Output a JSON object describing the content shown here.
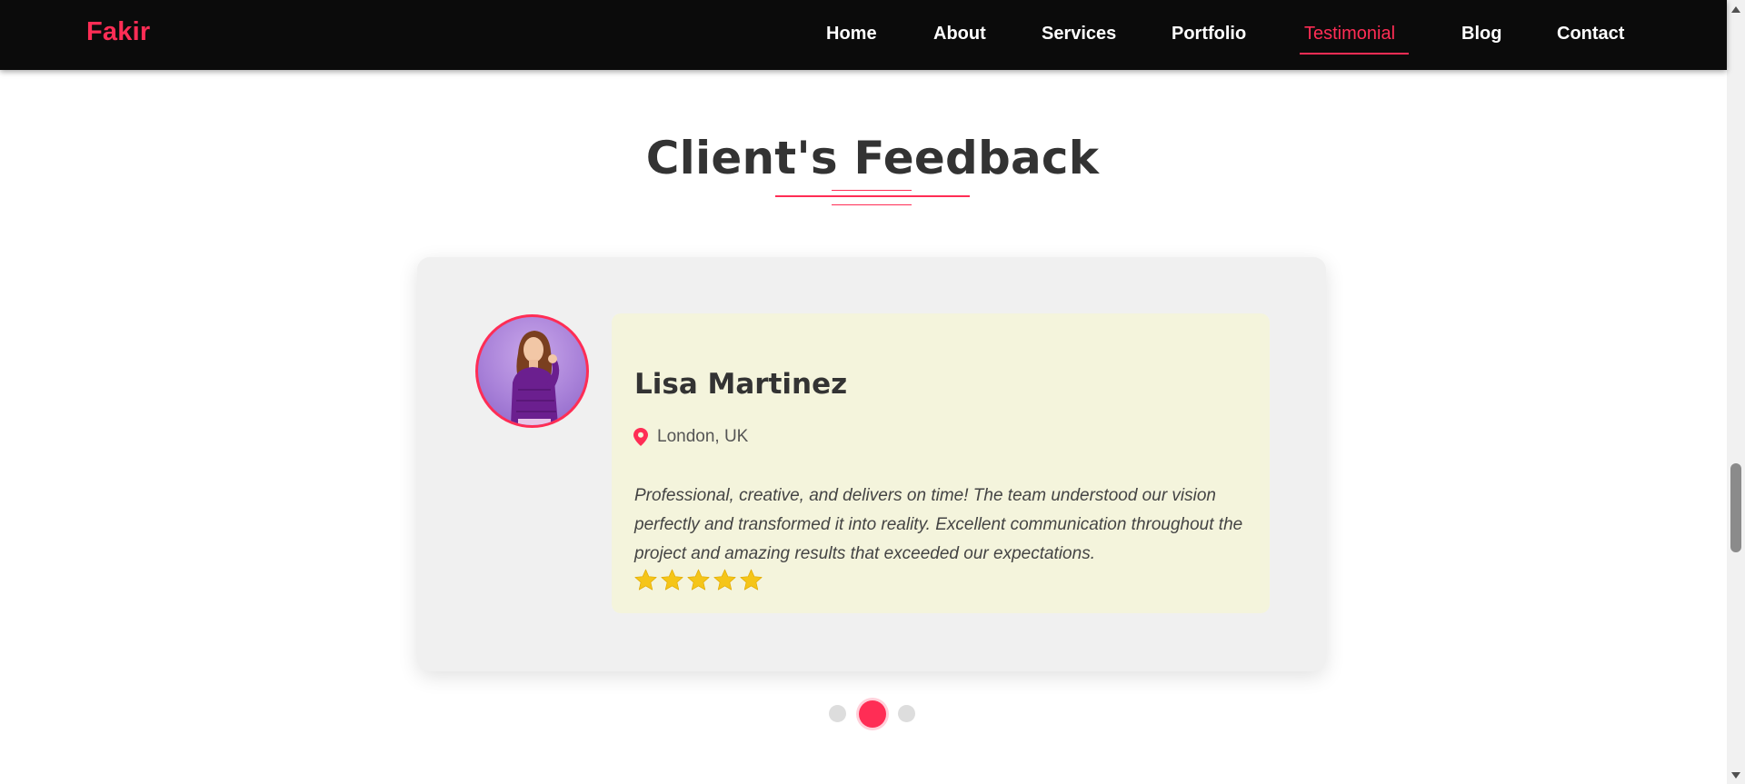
{
  "brand": {
    "logo": "Fakir",
    "accent_color": "#ff2d55"
  },
  "nav": {
    "items": [
      {
        "label": "Home"
      },
      {
        "label": "About"
      },
      {
        "label": "Services"
      },
      {
        "label": "Portfolio"
      },
      {
        "label": "Testimonial",
        "active": true
      },
      {
        "label": "Blog"
      },
      {
        "label": "Contact"
      }
    ]
  },
  "section": {
    "title": "Client's Feedback"
  },
  "testimonial": {
    "name": "Lisa Martinez",
    "location": "London, UK",
    "location_icon": "map-pin-icon",
    "text": "Professional, creative, and delivers on time! The team understood our vision perfectly and transformed it into reality. Excellent communication throughout the project and amazing results that exceeded our expectations.",
    "rating": 5,
    "rating_max": 5,
    "star_color": "#f5c518",
    "content_bg": "#f4f4dc"
  },
  "carousel": {
    "slides": 3,
    "active_index": 1
  }
}
